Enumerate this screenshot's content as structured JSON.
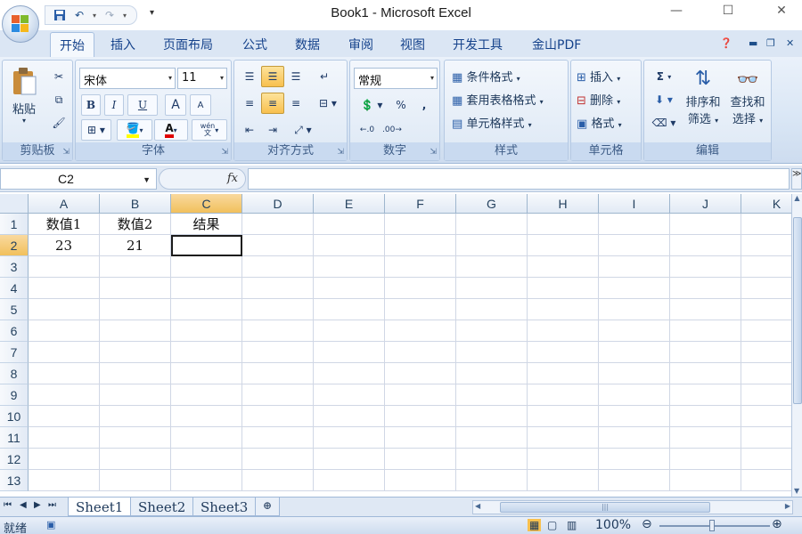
{
  "window": {
    "title": "Book1 - Microsoft Excel",
    "minimize": "—",
    "maximize": "☐",
    "close": "✕"
  },
  "tabs": [
    "开始",
    "插入",
    "页面布局",
    "公式",
    "数据",
    "审阅",
    "视图",
    "开发工具",
    "金山PDF"
  ],
  "active_tab": "开始",
  "ribbon": {
    "clipboard": {
      "label": "剪贴板",
      "paste": "粘贴"
    },
    "font": {
      "label": "字体",
      "font_name": "宋体",
      "font_size": "11",
      "bold": "B",
      "italic": "I",
      "underline": "U",
      "grow": "A",
      "shrink": "A",
      "color_letter": "A",
      "wen": "wén"
    },
    "alignment": {
      "label": "对齐方式"
    },
    "number": {
      "label": "数字",
      "format": "常规",
      "percent": "%",
      "comma": ","
    },
    "styles": {
      "label": "样式",
      "conditional": "条件格式",
      "table": "套用表格格式",
      "cell": "单元格样式"
    },
    "cells": {
      "label": "单元格",
      "insert": "插入",
      "delete": "删除",
      "format": "格式"
    },
    "editing": {
      "label": "编辑",
      "sum": "Σ",
      "sort_1": "排序和",
      "sort_2": "筛选",
      "find_1": "查找和",
      "find_2": "选择"
    }
  },
  "formula_bar": {
    "name_box": "C2",
    "fx": "fx",
    "content": ""
  },
  "grid": {
    "columns": [
      "A",
      "B",
      "C",
      "D",
      "E",
      "F",
      "G",
      "H",
      "I",
      "J",
      "K"
    ],
    "rows": [
      "1",
      "2",
      "3",
      "4",
      "5",
      "6",
      "7",
      "8",
      "9",
      "10",
      "11",
      "12",
      "13"
    ],
    "cells": {
      "A1": "数值1",
      "B1": "数值2",
      "C1": "结果",
      "A2": "23",
      "B2": "21"
    },
    "selected": "C2"
  },
  "sheets": [
    "Sheet1",
    "Sheet2",
    "Sheet3"
  ],
  "active_sheet": "Sheet1",
  "status": {
    "ready": "就绪",
    "zoom": "100%"
  },
  "colors": {
    "accent": "#15428b",
    "selection": "#f1c05c"
  }
}
